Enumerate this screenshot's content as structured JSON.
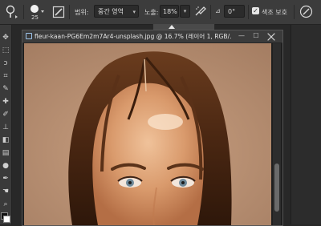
{
  "options_bar": {
    "range_label": "범위:",
    "range_value": "중간 영역",
    "exposure_label": "노출:",
    "exposure_value": "18%",
    "exposure_slider_fraction": 0.28,
    "angle_icon_label": "⊿",
    "angle_value": "0°",
    "protect_tones_label": "색조 보호",
    "protect_tones_checked": true
  },
  "document": {
    "title": "fleur-kaan-PG6Em2m7Ar4-unsplash.jpg @ 16.7% (레이어 1, RGB/...",
    "minimize_glyph": "—",
    "maximize_glyph": "☐"
  },
  "colors": {
    "background": "#282828",
    "panel": "#3c3c3c",
    "accent": "#9cc3ea"
  },
  "toolbar": {
    "tools": [
      "move-tool",
      "marquee-tool",
      "lasso-tool",
      "crop-tool",
      "eyedropper-tool",
      "healing-tool",
      "brush-tool",
      "clone-tool",
      "eraser-tool",
      "gradient-tool",
      "dodge-tool",
      "pen-tool",
      "type-tool",
      "hand-tool",
      "zoom-tool"
    ]
  }
}
